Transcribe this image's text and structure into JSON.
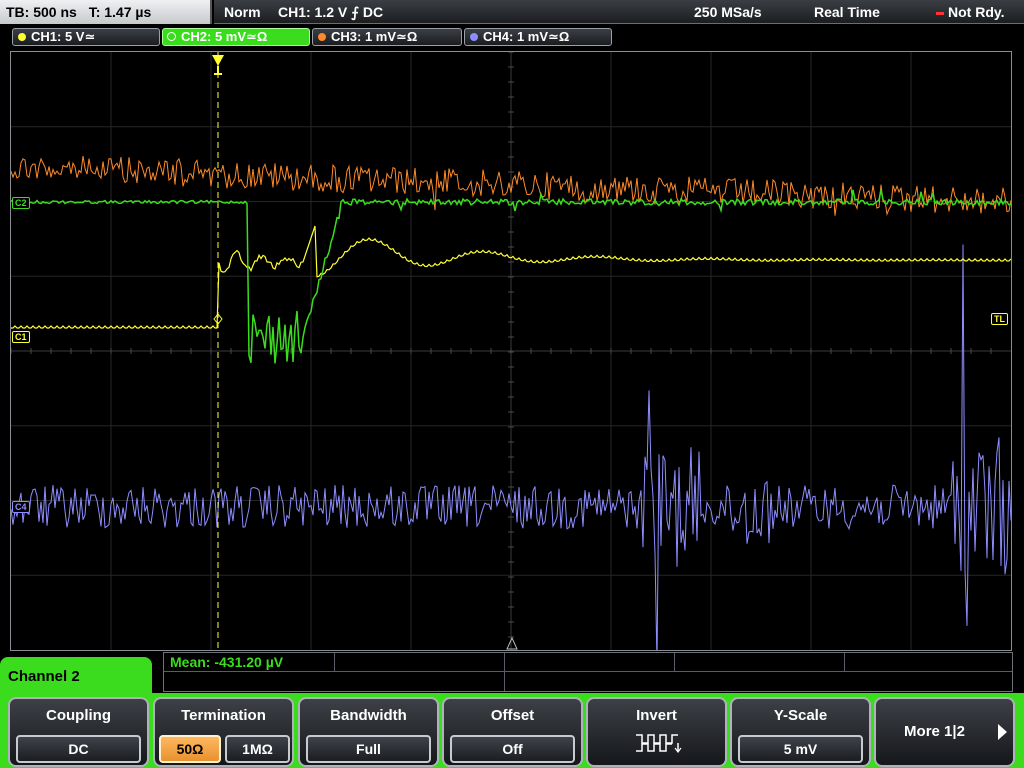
{
  "top_bar": {
    "timebase": "TB: 500 ns",
    "trigger_time": "T: 1.47 µs",
    "trigger_mode": "Norm",
    "trigger_source": "CH1: 1.2 V ⨍ DC",
    "sample_rate": "250 MSa/s",
    "acq_mode": "Real Time",
    "status": "Not Rdy."
  },
  "channels": [
    {
      "label": "CH1: 5 V≃",
      "color": "#ffff33",
      "active": false
    },
    {
      "label": "CH2: 5 mV≃Ω",
      "color": "#3bdc1e",
      "active": true
    },
    {
      "label": "CH3: 1 mV≃Ω",
      "color": "#ff8a2a",
      "active": false
    },
    {
      "label": "CH4: 1 mV≃Ω",
      "color": "#8d8dff",
      "active": false
    }
  ],
  "markers": {
    "ch1": "C1",
    "ch2": "C2",
    "ch4": "C4",
    "trigger_level": "TL"
  },
  "measurement": {
    "mean": "Mean: -431.20 µV"
  },
  "channel_menu_title": "Channel 2",
  "softkeys": {
    "coupling": {
      "title": "Coupling",
      "value": "DC"
    },
    "termination": {
      "title": "Termination",
      "options": [
        "50Ω",
        "1MΩ"
      ],
      "selected": "50Ω"
    },
    "bandwidth": {
      "title": "Bandwidth",
      "value": "Full"
    },
    "offset": {
      "title": "Offset",
      "value": "Off"
    },
    "invert": {
      "title": "Invert"
    },
    "yscale": {
      "title": "Y-Scale",
      "value": "5 mV"
    },
    "more": {
      "label": "More 1|2"
    }
  }
}
